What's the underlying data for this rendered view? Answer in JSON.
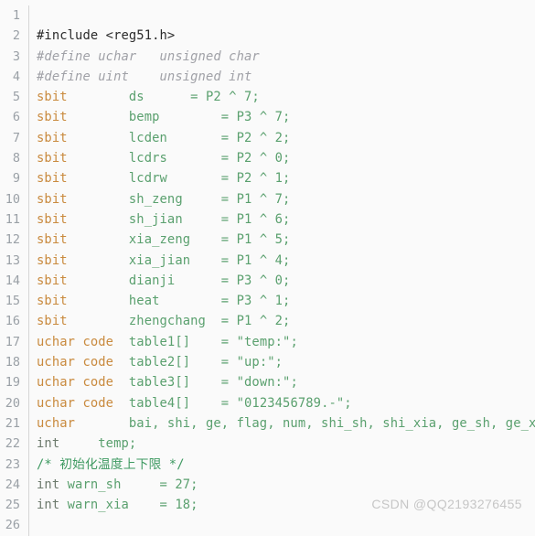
{
  "editor": {
    "language": "c",
    "background_color": "#fafafa",
    "gutter_color": "#9aa0a6",
    "gutter_rule_color": "#d6d6d6",
    "total_lines": 26,
    "first_visible_line": 1,
    "last_visible_line": 26,
    "colors": {
      "plain": "#2b2b2b",
      "comment_gray": "#a0a1a7",
      "comment_green": "#3f9a62",
      "keyword": "#c98a3e",
      "type": "#6d7a6d",
      "identifier": "#5aa06e",
      "string": "#5aa06e",
      "number": "#5aa06e",
      "operator": "#5aa06e"
    }
  },
  "lines": [
    {
      "number": "1",
      "tokens": []
    },
    {
      "number": "2",
      "tokens": [
        {
          "t": "#include <reg51.h>",
          "c": "tok-preproc"
        }
      ]
    },
    {
      "number": "3",
      "tokens": [
        {
          "t": "#define uchar   unsigned char",
          "c": "tok-comment-gray"
        }
      ]
    },
    {
      "number": "4",
      "tokens": [
        {
          "t": "#define uint    unsigned int",
          "c": "tok-comment-gray"
        }
      ]
    },
    {
      "number": "5",
      "tokens": [
        {
          "t": "sbit",
          "c": "tok-keyword"
        },
        {
          "t": "        ds      ",
          "c": "tok-ident"
        },
        {
          "t": "= P2 ^ 7;",
          "c": "tok-op"
        }
      ]
    },
    {
      "number": "6",
      "tokens": [
        {
          "t": "sbit",
          "c": "tok-keyword"
        },
        {
          "t": "        bemp        ",
          "c": "tok-ident"
        },
        {
          "t": "= P3 ^ 7;",
          "c": "tok-op"
        }
      ]
    },
    {
      "number": "7",
      "tokens": [
        {
          "t": "sbit",
          "c": "tok-keyword"
        },
        {
          "t": "        lcden       ",
          "c": "tok-ident"
        },
        {
          "t": "= P2 ^ 2;",
          "c": "tok-op"
        }
      ]
    },
    {
      "number": "8",
      "tokens": [
        {
          "t": "sbit",
          "c": "tok-keyword"
        },
        {
          "t": "        lcdrs       ",
          "c": "tok-ident"
        },
        {
          "t": "= P2 ^ 0;",
          "c": "tok-op"
        }
      ]
    },
    {
      "number": "9",
      "tokens": [
        {
          "t": "sbit",
          "c": "tok-keyword"
        },
        {
          "t": "        lcdrw       ",
          "c": "tok-ident"
        },
        {
          "t": "= P2 ^ 1;",
          "c": "tok-op"
        }
      ]
    },
    {
      "number": "10",
      "tokens": [
        {
          "t": "sbit",
          "c": "tok-keyword"
        },
        {
          "t": "        sh_zeng     ",
          "c": "tok-ident"
        },
        {
          "t": "= P1 ^ 7;",
          "c": "tok-op"
        }
      ]
    },
    {
      "number": "11",
      "tokens": [
        {
          "t": "sbit",
          "c": "tok-keyword"
        },
        {
          "t": "        sh_jian     ",
          "c": "tok-ident"
        },
        {
          "t": "= P1 ^ 6;",
          "c": "tok-op"
        }
      ]
    },
    {
      "number": "12",
      "tokens": [
        {
          "t": "sbit",
          "c": "tok-keyword"
        },
        {
          "t": "        xia_zeng    ",
          "c": "tok-ident"
        },
        {
          "t": "= P1 ^ 5;",
          "c": "tok-op"
        }
      ]
    },
    {
      "number": "13",
      "tokens": [
        {
          "t": "sbit",
          "c": "tok-keyword"
        },
        {
          "t": "        xia_jian    ",
          "c": "tok-ident"
        },
        {
          "t": "= P1 ^ 4;",
          "c": "tok-op"
        }
      ]
    },
    {
      "number": "14",
      "tokens": [
        {
          "t": "sbit",
          "c": "tok-keyword"
        },
        {
          "t": "        dianji      ",
          "c": "tok-ident"
        },
        {
          "t": "= P3 ^ 0;",
          "c": "tok-op"
        }
      ]
    },
    {
      "number": "15",
      "tokens": [
        {
          "t": "sbit",
          "c": "tok-keyword"
        },
        {
          "t": "        heat        ",
          "c": "tok-ident"
        },
        {
          "t": "= P3 ^ 1;",
          "c": "tok-op"
        }
      ]
    },
    {
      "number": "16",
      "tokens": [
        {
          "t": "sbit",
          "c": "tok-keyword"
        },
        {
          "t": "        zhengchang  ",
          "c": "tok-ident"
        },
        {
          "t": "= P1 ^ 2;",
          "c": "tok-op"
        }
      ]
    },
    {
      "number": "17",
      "tokens": [
        {
          "t": "uchar code",
          "c": "tok-keyword"
        },
        {
          "t": "  table1[]    ",
          "c": "tok-ident"
        },
        {
          "t": "= ",
          "c": "tok-op"
        },
        {
          "t": "\"temp:\";",
          "c": "tok-string"
        }
      ]
    },
    {
      "number": "18",
      "tokens": [
        {
          "t": "uchar code",
          "c": "tok-keyword"
        },
        {
          "t": "  table2[]    ",
          "c": "tok-ident"
        },
        {
          "t": "= ",
          "c": "tok-op"
        },
        {
          "t": "\"up:\";",
          "c": "tok-string"
        }
      ]
    },
    {
      "number": "19",
      "tokens": [
        {
          "t": "uchar code",
          "c": "tok-keyword"
        },
        {
          "t": "  table3[]    ",
          "c": "tok-ident"
        },
        {
          "t": "= ",
          "c": "tok-op"
        },
        {
          "t": "\"down:\";",
          "c": "tok-string"
        }
      ]
    },
    {
      "number": "20",
      "tokens": [
        {
          "t": "uchar code",
          "c": "tok-keyword"
        },
        {
          "t": "  table4[]    ",
          "c": "tok-ident"
        },
        {
          "t": "= ",
          "c": "tok-op"
        },
        {
          "t": "\"0123456789.-\";",
          "c": "tok-string"
        }
      ]
    },
    {
      "number": "21",
      "tokens": [
        {
          "t": "uchar",
          "c": "tok-keyword"
        },
        {
          "t": "       bai, shi, ge, flag, num, shi_sh, shi_xia, ge_sh, ge_xia;",
          "c": "tok-ident"
        }
      ]
    },
    {
      "number": "22",
      "tokens": [
        {
          "t": "int",
          "c": "tok-type"
        },
        {
          "t": "     temp;",
          "c": "tok-ident"
        }
      ]
    },
    {
      "number": "23",
      "tokens": [
        {
          "t": "/* 初始化温度上下限 */",
          "c": "tok-comment"
        }
      ]
    },
    {
      "number": "24",
      "tokens": [
        {
          "t": "int",
          "c": "tok-type"
        },
        {
          "t": " warn_sh",
          "c": "tok-ident"
        },
        {
          "t": "     = ",
          "c": "tok-op"
        },
        {
          "t": "27;",
          "c": "tok-number"
        }
      ]
    },
    {
      "number": "25",
      "tokens": [
        {
          "t": "int",
          "c": "tok-type"
        },
        {
          "t": " warn_xia",
          "c": "tok-ident"
        },
        {
          "t": "    = ",
          "c": "tok-op"
        },
        {
          "t": "18;",
          "c": "tok-number"
        }
      ]
    },
    {
      "number": "26",
      "tokens": []
    }
  ],
  "watermark": {
    "text": "CSDN @QQ2193276455"
  }
}
